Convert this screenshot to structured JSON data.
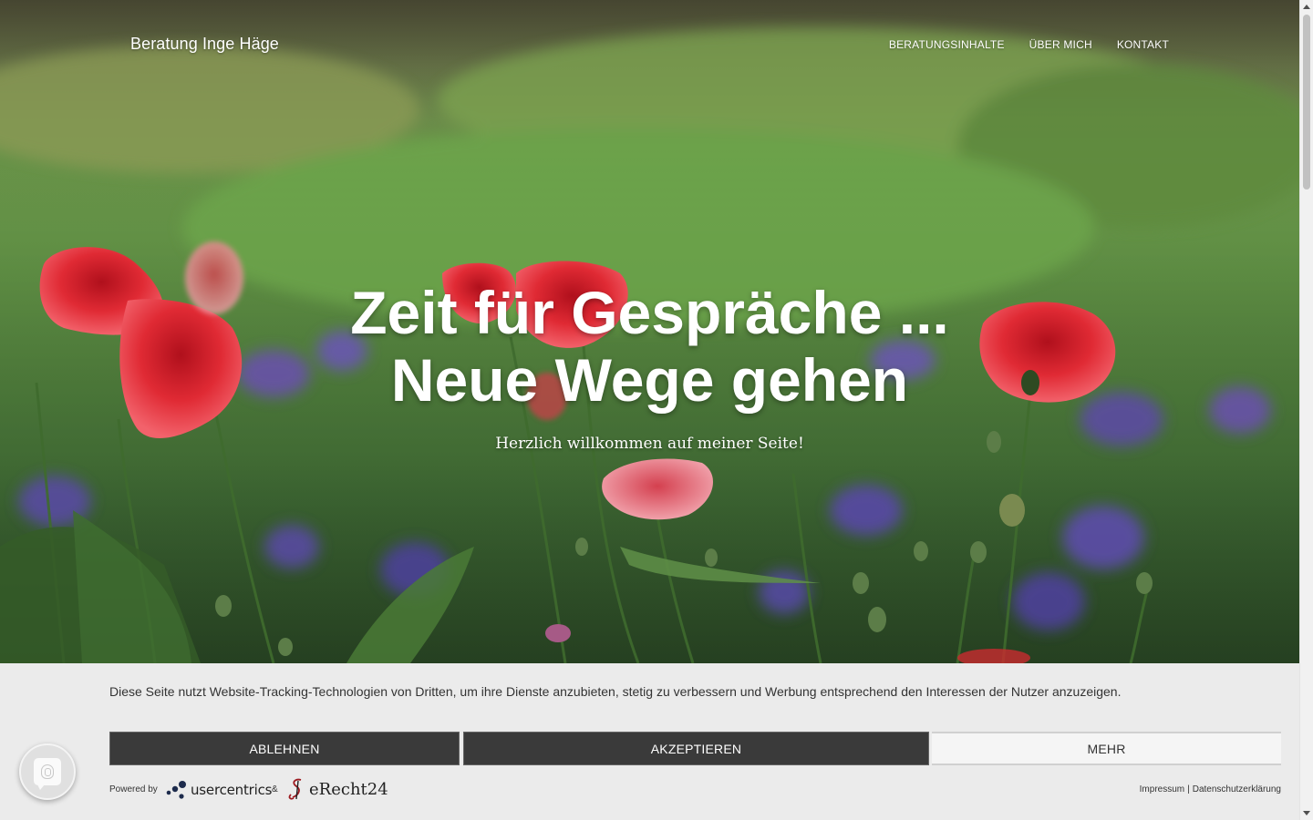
{
  "site": {
    "brand": "Beratung Inge Häge",
    "nav": [
      "BERATUNGSINHALTE",
      "ÜBER MICH",
      "KONTAKT"
    ]
  },
  "hero": {
    "headline_line1": "Zeit für Gespräche ...",
    "headline_line2": "Neue Wege gehen",
    "subline": "Herzlich willkommen auf meiner Seite!"
  },
  "consent": {
    "text": "Diese Seite nutzt Website-Tracking-Technologien von Dritten, um ihre Dienste anzubieten, stetig zu verbessern und Werbung entsprechend den Interessen der Nutzer anzuzeigen.",
    "deny_label": "ABLEHNEN",
    "accept_label": "AKZEPTIEREN",
    "more_label": "MEHR",
    "powered_by": "Powered by",
    "usercentrics": "usercentrics",
    "ampersand": "&",
    "erecht": "eRecht24",
    "impressum": "Impressum",
    "separator": "|",
    "datenschutz": "Datenschutzerklärung"
  },
  "colors": {
    "button_dark": "#3a3a3a",
    "banner_bg": "#ebebeb",
    "poppy_red": "#d8262f"
  },
  "icons": {
    "privacy": "fingerprint-icon"
  }
}
